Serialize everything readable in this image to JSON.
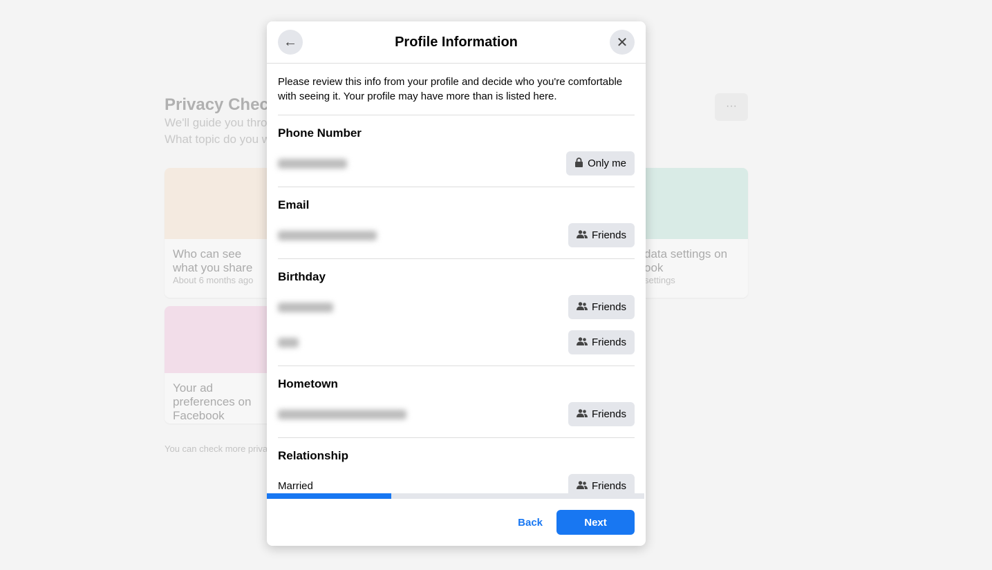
{
  "background": {
    "title": "Privacy Check",
    "subtitle_1": "We'll guide you thro",
    "subtitle_2": "What topic do you w",
    "more_label": "···",
    "cards": [
      {
        "title": "Who can see what you share",
        "meta": "About 6 months ago"
      },
      {
        "title": "data settings on ook",
        "meta": "settings"
      },
      {
        "title": "Your ad preferences on Facebook"
      }
    ],
    "footer": "You can check more privacy"
  },
  "modal": {
    "title": "Profile Information",
    "intro": "Please review this info from your profile and decide who you're comfortable with seeing it. Your profile may have more than is listed here.",
    "sections": [
      {
        "heading": "Phone Number",
        "rows": [
          {
            "value": "",
            "audience": "Only me",
            "icon": "lock-icon"
          }
        ]
      },
      {
        "heading": "Email",
        "rows": [
          {
            "value": "",
            "audience": "Friends",
            "icon": "friends-icon"
          }
        ]
      },
      {
        "heading": "Birthday",
        "rows": [
          {
            "value": "",
            "audience": "Friends",
            "icon": "friends-icon"
          },
          {
            "value": "",
            "audience": "Friends",
            "icon": "friends-icon"
          }
        ]
      },
      {
        "heading": "Hometown",
        "rows": [
          {
            "value": "",
            "audience": "Friends",
            "icon": "friends-icon"
          }
        ]
      },
      {
        "heading": "Relationship",
        "rows": [
          {
            "value": "Married",
            "audience": "Friends",
            "icon": "friends-icon"
          }
        ]
      }
    ],
    "progress_percent": 33,
    "back_label": "Back",
    "next_label": "Next",
    "accent": "#1877f2"
  }
}
